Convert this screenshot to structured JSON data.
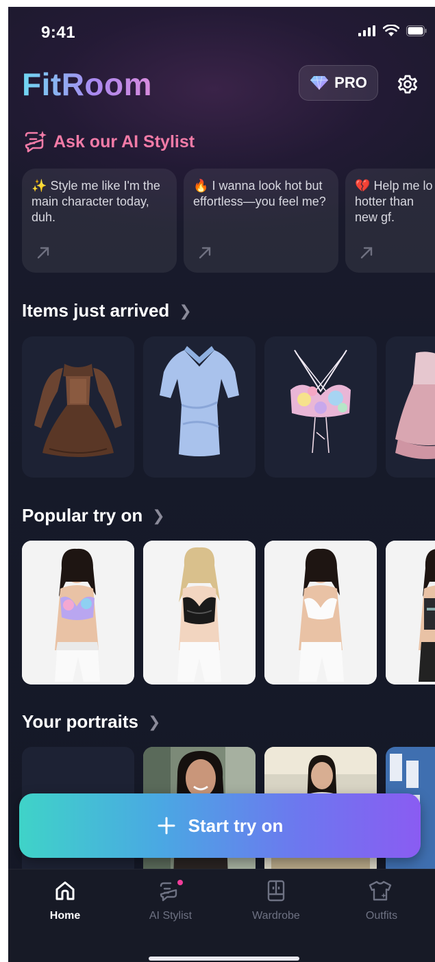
{
  "status": {
    "time": "9:41"
  },
  "header": {
    "app_title": "FitRoom",
    "pro_label": "PRO"
  },
  "ai_stylist": {
    "title": "Ask our AI Stylist",
    "prompts": [
      {
        "emoji": "✨",
        "text": "Style me like I'm the main character today, duh."
      },
      {
        "emoji": "🔥",
        "text": "I wanna look hot but effortless—you feel me?"
      },
      {
        "emoji": "💔",
        "text": "Help me lo hotter than new gf."
      }
    ]
  },
  "sections": {
    "items": "Items just arrived",
    "popular": "Popular try on",
    "portraits": "Your portraits"
  },
  "start_button": {
    "label": "Start try on"
  },
  "tabs": [
    {
      "label": "Home"
    },
    {
      "label": "AI Stylist"
    },
    {
      "label": "Wardrobe"
    },
    {
      "label": "Outfits"
    }
  ],
  "colors": {
    "accent_pink": "#f27ba7",
    "gradient_start": "#3fd3c8",
    "gradient_end": "#8a5cf2"
  }
}
